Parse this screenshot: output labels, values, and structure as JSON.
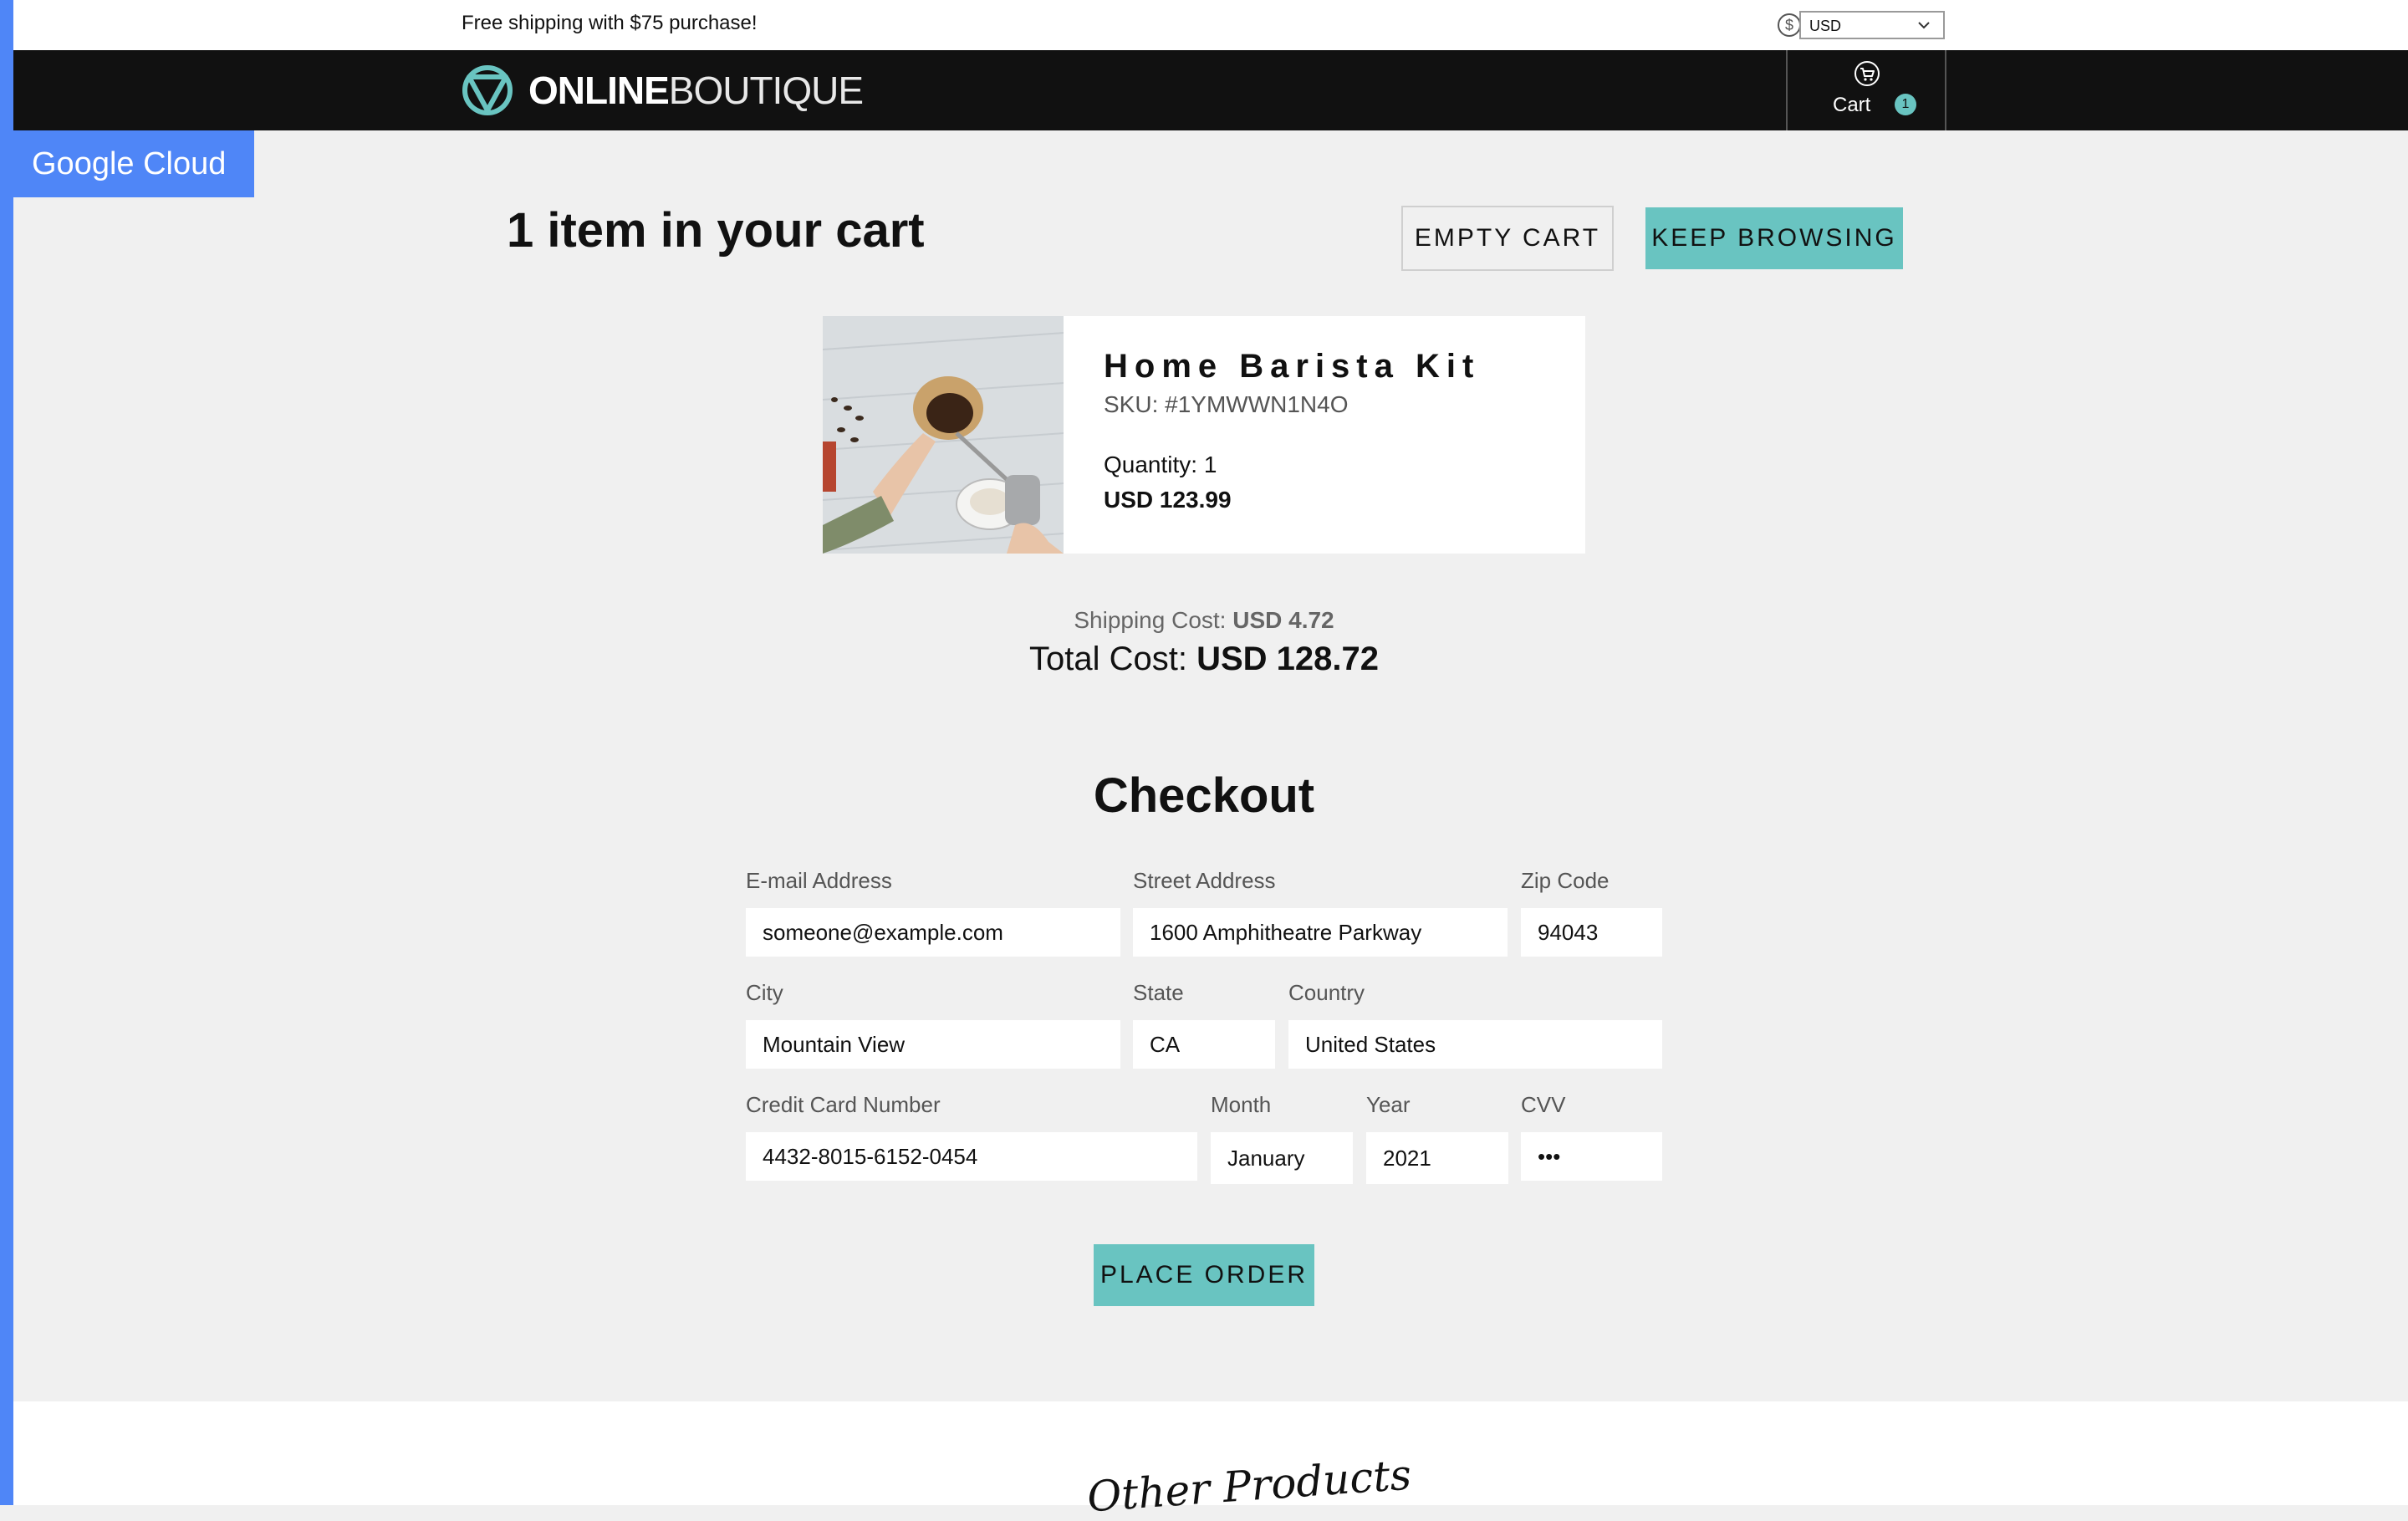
{
  "topbar": {
    "promo": "Free shipping with $75 purchase!",
    "currency_value": "USD",
    "currency_icon": "dollar-circle-icon"
  },
  "header": {
    "logo_bold": "ONLINE",
    "logo_light": "BOUTIQUE",
    "cart_label": "Cart",
    "cart_count": "1",
    "cart_icon": "shopping-cart-icon"
  },
  "google_cloud_tag": "Google Cloud",
  "cart": {
    "title": "1 item in your cart",
    "empty_button": "EMPTY CART",
    "keep_browsing_button": "KEEP BROWSING",
    "items": [
      {
        "name": "Home Barista Kit",
        "sku": "SKU: #1YMWWN1N4O",
        "quantity": "Quantity: 1",
        "price": "USD 123.99"
      }
    ],
    "shipping_label": "Shipping Cost: ",
    "shipping_value": "USD 4.72",
    "total_label": "Total Cost: ",
    "total_value": "USD 128.72"
  },
  "checkout": {
    "title": "Checkout",
    "fields": {
      "email": {
        "label": "E-mail Address",
        "value": "someone@example.com"
      },
      "street": {
        "label": "Street Address",
        "value": "1600 Amphitheatre Parkway"
      },
      "zip": {
        "label": "Zip Code",
        "value": "94043"
      },
      "city": {
        "label": "City",
        "value": "Mountain View"
      },
      "state": {
        "label": "State",
        "value": "CA"
      },
      "country": {
        "label": "Country",
        "value": "United States"
      },
      "card": {
        "label": "Credit Card Number",
        "value": "4432-8015-6152-0454"
      },
      "month": {
        "label": "Month",
        "value": "January"
      },
      "year": {
        "label": "Year",
        "value": "2021"
      },
      "cvv": {
        "label": "CVV",
        "value": "•••"
      }
    },
    "place_order_button": "PLACE ORDER"
  },
  "footer": {
    "other_products_heading": "Other Products"
  },
  "colors": {
    "accent": "#69c4c1",
    "header_bg": "#111111",
    "google_blue": "#4f86f7",
    "page_bg": "#f0f0f0"
  }
}
